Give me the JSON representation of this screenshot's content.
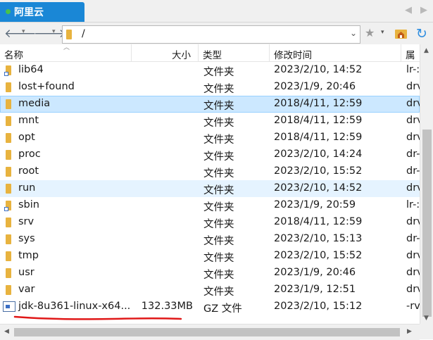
{
  "tab": {
    "title": "阿里云"
  },
  "tabnav": {
    "left": "◀",
    "right": "▶"
  },
  "address": {
    "path": "/",
    "back": "🡐",
    "forward": "🡒",
    "caret": "▾",
    "star": "★",
    "refresh": "↻",
    "dropdown": "⌄"
  },
  "columns": {
    "name": "名称",
    "size": "大小",
    "type": "类型",
    "modified": "修改时间",
    "attributes": "属"
  },
  "files": [
    {
      "name": "lib64",
      "size": "",
      "type": "文件夹",
      "modified": "2023/2/10, 14:52",
      "attr": "lr-:",
      "icon": "folder-link"
    },
    {
      "name": "lost+found",
      "size": "",
      "type": "文件夹",
      "modified": "2023/1/9, 20:46",
      "attr": "drv",
      "icon": "folder"
    },
    {
      "name": "media",
      "size": "",
      "type": "文件夹",
      "modified": "2018/4/11, 12:59",
      "attr": "drv",
      "icon": "folder"
    },
    {
      "name": "mnt",
      "size": "",
      "type": "文件夹",
      "modified": "2018/4/11, 12:59",
      "attr": "drv",
      "icon": "folder"
    },
    {
      "name": "opt",
      "size": "",
      "type": "文件夹",
      "modified": "2018/4/11, 12:59",
      "attr": "drv",
      "icon": "folder"
    },
    {
      "name": "proc",
      "size": "",
      "type": "文件夹",
      "modified": "2023/2/10, 14:24",
      "attr": "dr-",
      "icon": "folder"
    },
    {
      "name": "root",
      "size": "",
      "type": "文件夹",
      "modified": "2023/2/10, 15:52",
      "attr": "dr-",
      "icon": "folder"
    },
    {
      "name": "run",
      "size": "",
      "type": "文件夹",
      "modified": "2023/2/10, 14:52",
      "attr": "drv",
      "icon": "folder"
    },
    {
      "name": "sbin",
      "size": "",
      "type": "文件夹",
      "modified": "2023/1/9, 20:59",
      "attr": "lr-:",
      "icon": "folder-link"
    },
    {
      "name": "srv",
      "size": "",
      "type": "文件夹",
      "modified": "2018/4/11, 12:59",
      "attr": "drv",
      "icon": "folder"
    },
    {
      "name": "sys",
      "size": "",
      "type": "文件夹",
      "modified": "2023/2/10, 15:13",
      "attr": "dr-",
      "icon": "folder"
    },
    {
      "name": "tmp",
      "size": "",
      "type": "文件夹",
      "modified": "2023/2/10, 15:52",
      "attr": "drv",
      "icon": "folder"
    },
    {
      "name": "usr",
      "size": "",
      "type": "文件夹",
      "modified": "2023/1/9, 20:46",
      "attr": "drv",
      "icon": "folder"
    },
    {
      "name": "var",
      "size": "",
      "type": "文件夹",
      "modified": "2023/1/9, 12:51",
      "attr": "drv",
      "icon": "folder"
    },
    {
      "name": "jdk-8u361-linux-x64...",
      "size": "132.33MB",
      "type": "GZ 文件",
      "modified": "2023/2/10, 15:12",
      "attr": "-rv",
      "icon": "gz-file"
    }
  ],
  "selected_row": 2,
  "hover_row": 7,
  "colors": {
    "tab": "#1a87d6",
    "folder": "#e8b33f",
    "selected": "#cce8ff",
    "annotation": "#e01818"
  }
}
